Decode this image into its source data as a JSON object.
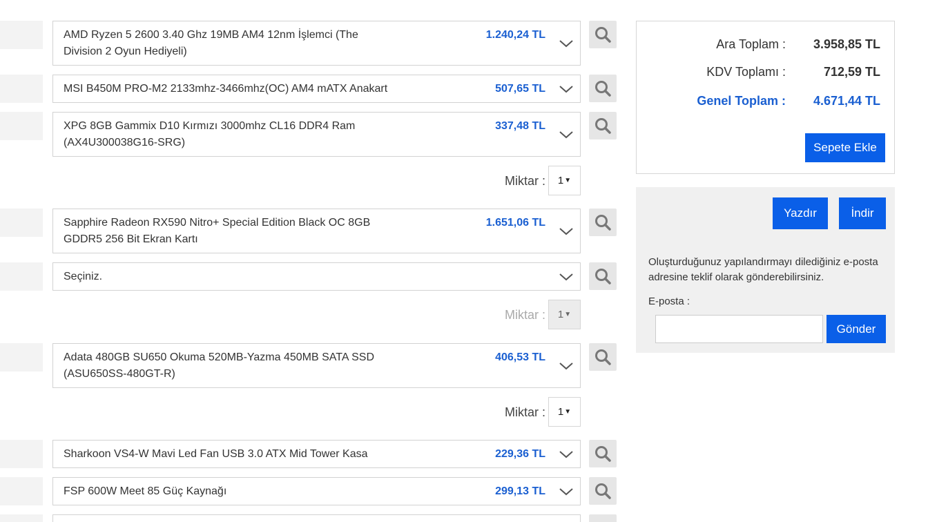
{
  "components": [
    {
      "name": "AMD Ryzen 5 2600 3.40 Ghz 19MB AM4 12nm İşlemci (The Division 2 Oyun Hediyeli)",
      "price": "1.240,24 TL"
    },
    {
      "name": "MSI B450M PRO-M2 2133mhz-3466mhz(OC) AM4 mATX Anakart",
      "price": "507,65 TL"
    },
    {
      "name": "XPG 8GB Gammix D10 Kırmızı 3000mhz CL16 DDR4 Ram (AX4U300038G16-SRG)",
      "price": "337,48 TL"
    },
    {
      "name": "Sapphire Radeon RX590 Nitro+ Special Edition Black OC 8GB GDDR5 256 Bit Ekran Kartı",
      "price": "1.651,06 TL"
    },
    {
      "name": "Seçiniz.",
      "price": ""
    },
    {
      "name": "Adata 480GB SU650 Okuma 520MB-Yazma 450MB SATA SSD (ASU650SS-480GT-R)",
      "price": "406,53 TL"
    },
    {
      "name": "Sharkoon VS4-W Mavi Led Fan USB 3.0 ATX Mid Tower Kasa",
      "price": "229,36 TL"
    },
    {
      "name": "FSP 600W Meet 85 Güç Kaynağı",
      "price": "299,13 TL"
    },
    {
      "name": "",
      "price": ""
    }
  ],
  "quantity": {
    "label": "Miktar :",
    "ram_value": "1",
    "storage_value": "1",
    "ssd_value": "1"
  },
  "summary": {
    "subtotal_label": "Ara Toplam :",
    "subtotal_value": "3.958,85 TL",
    "vat_label": "KDV Toplamı :",
    "vat_value": "712,59 TL",
    "total_label": "Genel Toplam :",
    "total_value": "4.671,44 TL",
    "add_to_cart": "Sepete Ekle"
  },
  "share": {
    "print_label": "Yazdır",
    "download_label": "İndir",
    "description": "Oluşturduğunuz yapılandırmayı dilediğiniz e-posta adresine teklif olarak gönderebilirsiniz.",
    "email_label": "E-posta :",
    "email_value": "",
    "send_label": "Gönder"
  },
  "colors": {
    "accent": "#1a5fd1",
    "button": "#0a5fe8"
  }
}
